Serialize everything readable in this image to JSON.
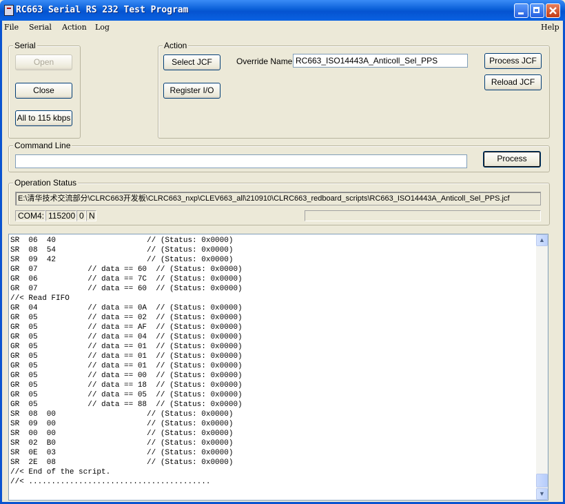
{
  "window": {
    "title": "RC663 Serial RS 232 Test Program"
  },
  "menu": {
    "file": "File",
    "serial": "Serial",
    "action": "Action",
    "log": "Log",
    "help": "Help"
  },
  "serial_group": {
    "label": "Serial",
    "open": "Open",
    "close": "Close",
    "all_to": "All to 115 kbps"
  },
  "action_group": {
    "label": "Action",
    "select_jcf": "Select JCF",
    "register_io": "Register I/O",
    "override_label": "Override Name:",
    "override_value": "RC663_ISO14443A_Anticoll_Sel_PPS",
    "process_jcf": "Process JCF",
    "reload_jcf": "Reload JCF"
  },
  "command_group": {
    "label": "Command Line",
    "value": "",
    "process": "Process"
  },
  "status_group": {
    "label": "Operation Status",
    "path": "E:\\清华技术交流部分\\CLRC663开发板\\CLRC663_nxp\\CLEV663_all\\210910\\CLRC663_redboard_scripts\\RC663_ISO14443A_Anticoll_Sel_PPS.jcf",
    "port": "COM4:",
    "baud": "115200",
    "parity": "0",
    "flow": "N"
  },
  "console": {
    "lines": [
      "SR  06  40                    // (Status: 0x0000)",
      "SR  08  54                    // (Status: 0x0000)",
      "SR  09  42                    // (Status: 0x0000)",
      "GR  07           // data == 60  // (Status: 0x0000)",
      "GR  06           // data == 7C  // (Status: 0x0000)",
      "GR  07           // data == 60  // (Status: 0x0000)",
      "//< Read FIFO",
      "GR  04           // data == 0A  // (Status: 0x0000)",
      "GR  05           // data == 02  // (Status: 0x0000)",
      "GR  05           // data == AF  // (Status: 0x0000)",
      "GR  05           // data == 04  // (Status: 0x0000)",
      "GR  05           // data == 01  // (Status: 0x0000)",
      "GR  05           // data == 01  // (Status: 0x0000)",
      "GR  05           // data == 01  // (Status: 0x0000)",
      "GR  05           // data == 00  // (Status: 0x0000)",
      "GR  05           // data == 18  // (Status: 0x0000)",
      "GR  05           // data == 05  // (Status: 0x0000)",
      "GR  05           // data == 88  // (Status: 0x0000)",
      "SR  08  00                    // (Status: 0x0000)",
      "SR  09  00                    // (Status: 0x0000)",
      "SR  00  00                    // (Status: 0x0000)",
      "SR  02  B0                    // (Status: 0x0000)",
      "SR  0E  03                    // (Status: 0x0000)",
      "SR  2E  08                    // (Status: 0x0000)",
      "//< End of the script.",
      "//< ........................................"
    ]
  },
  "icons": {
    "app": "app-icon",
    "minimize": "minimize-icon",
    "maximize": "maximize-icon",
    "close": "close-icon"
  },
  "colors": {
    "titlebar": "#0a5fd8",
    "face": "#ece9d8",
    "close_button": "#c43b14"
  }
}
